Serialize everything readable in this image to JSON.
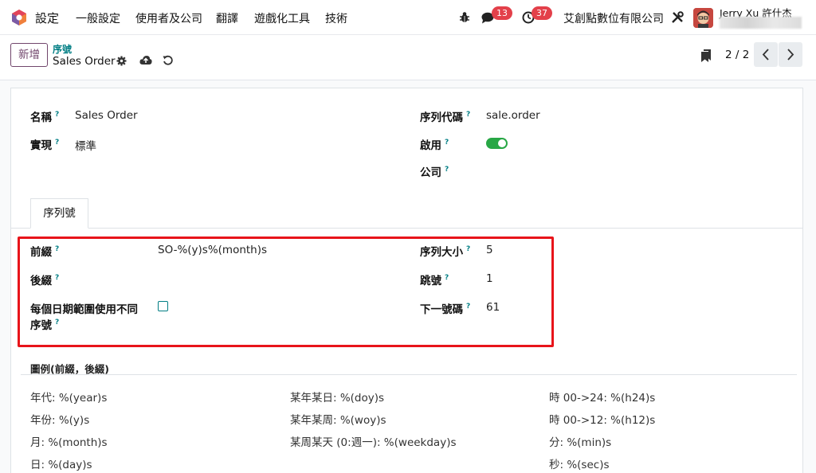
{
  "navbar": {
    "app_name": "設定",
    "menu": [
      "一般設定",
      "使用者及公司",
      "翻譯",
      "遊戲化工具",
      "技術"
    ],
    "messages_count": "13",
    "activities_count": "37",
    "company": "艾創點數位有限公司",
    "username": "Jerry Xu 許什杰"
  },
  "control": {
    "new_label": "新增",
    "breadcrumb_parent": "序號",
    "breadcrumb_current": "Sales Order",
    "pager": "2 / 2"
  },
  "form": {
    "name_label": "名稱",
    "name_value": "Sales Order",
    "impl_label": "實現",
    "impl_value": "標準",
    "code_label": "序列代碼",
    "code_value": "sale.order",
    "active_label": "啟用",
    "active_value": true,
    "company_label": "公司",
    "company_value": ""
  },
  "tab": {
    "label": "序列號"
  },
  "sequence": {
    "prefix_label": "前綴",
    "prefix_value": "SO-%(y)s%(month)s",
    "suffix_label": "後綴",
    "suffix_value": "",
    "date_range_label_1": "每個日期範圍使用不同",
    "date_range_label_2": "序號",
    "date_range_checked": false,
    "size_label": "序列大小",
    "size_value": "5",
    "step_label": "跳號",
    "step_value": "1",
    "next_label": "下一號碼",
    "next_value": "61"
  },
  "legend": {
    "title": "圖例(前綴，後綴)",
    "col1": [
      "年代: %(year)s",
      "年份: %(y)s",
      "月: %(month)s",
      "日: %(day)s"
    ],
    "col2": [
      "某年某日: %(doy)s",
      "某年某周: %(woy)s",
      "某周某天 (0:週一): %(weekday)s"
    ],
    "col3": [
      "時 00->24: %(h24)s",
      "時 00->12: %(h12)s",
      "分: %(min)s",
      "秒: %(sec)s"
    ]
  },
  "colors": {
    "brand": "#71466c",
    "accent": "#017e84",
    "badge": "#e3404a",
    "toggle_on": "#28a745",
    "highlight": "#e8141a"
  }
}
